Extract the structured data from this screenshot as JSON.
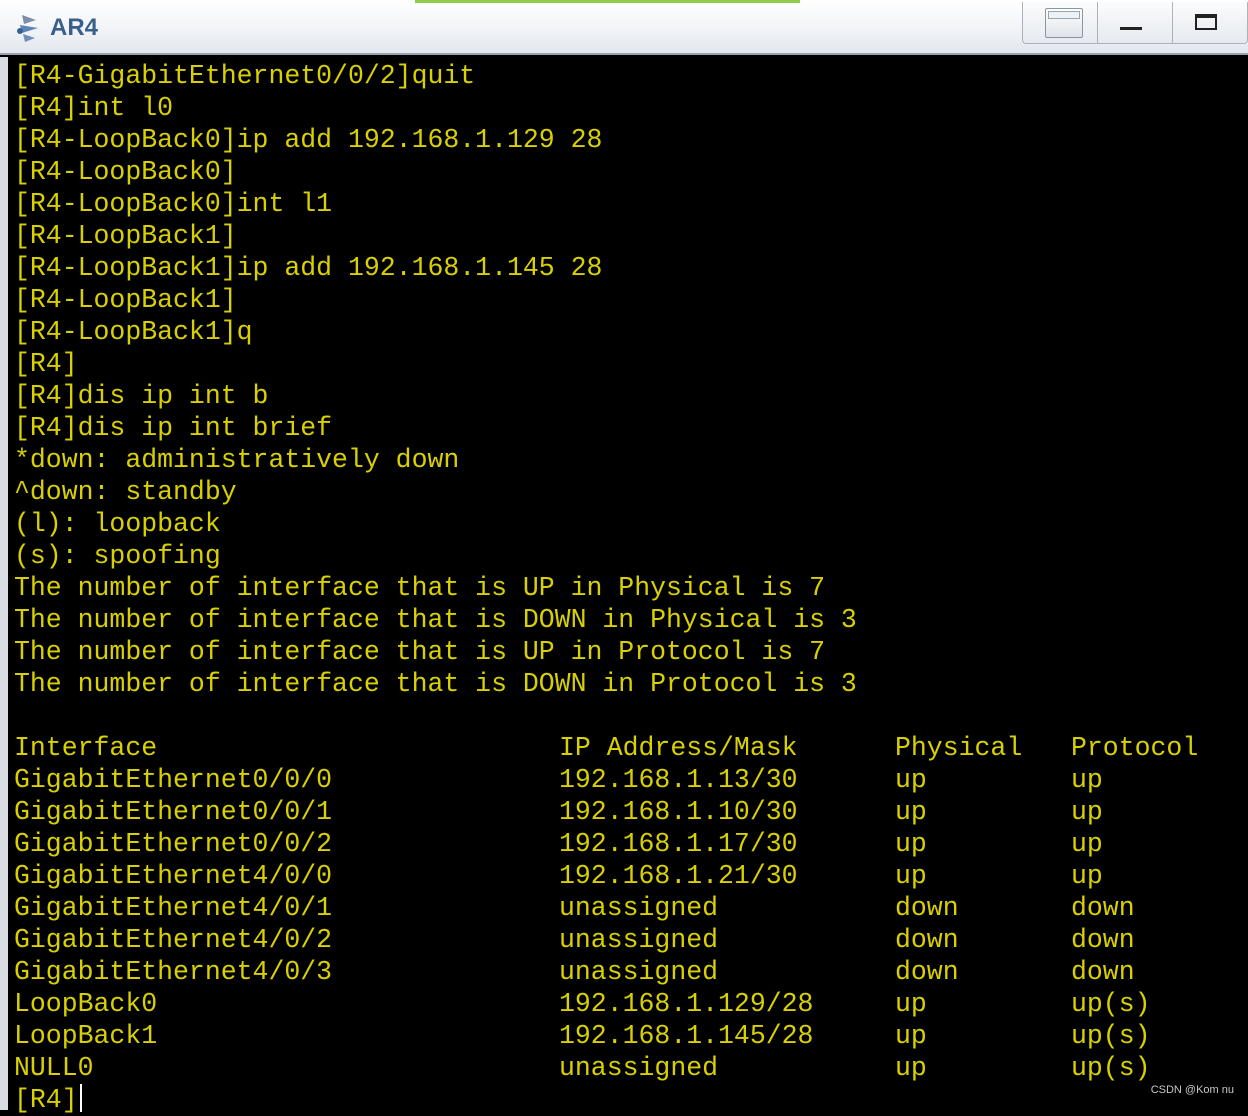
{
  "window": {
    "title": "AR4"
  },
  "console_lines": [
    "[R4-GigabitEthernet0/0/2]quit",
    "[R4]int l0",
    "[R4-LoopBack0]ip add 192.168.1.129 28",
    "[R4-LoopBack0]",
    "[R4-LoopBack0]int l1",
    "[R4-LoopBack1]",
    "[R4-LoopBack1]ip add 192.168.1.145 28",
    "[R4-LoopBack1]",
    "[R4-LoopBack1]q",
    "[R4]",
    "[R4]dis ip int b",
    "[R4]dis ip int brief",
    "*down: administratively down",
    "^down: standby",
    "(l): loopback",
    "(s): spoofing",
    "The number of interface that is UP in Physical is 7",
    "The number of interface that is DOWN in Physical is 3",
    "The number of interface that is UP in Protocol is 7",
    "The number of interface that is DOWN in Protocol is 3"
  ],
  "interface_table": {
    "headers": [
      "Interface",
      "IP Address/Mask",
      "Physical",
      "Protocol"
    ],
    "rows": [
      [
        "GigabitEthernet0/0/0",
        "192.168.1.13/30",
        "up",
        "up"
      ],
      [
        "GigabitEthernet0/0/1",
        "192.168.1.10/30",
        "up",
        "up"
      ],
      [
        "GigabitEthernet0/0/2",
        "192.168.1.17/30",
        "up",
        "up"
      ],
      [
        "GigabitEthernet4/0/0",
        "192.168.1.21/30",
        "up",
        "up"
      ],
      [
        "GigabitEthernet4/0/1",
        "unassigned",
        "down",
        "down"
      ],
      [
        "GigabitEthernet4/0/2",
        "unassigned",
        "down",
        "down"
      ],
      [
        "GigabitEthernet4/0/3",
        "unassigned",
        "down",
        "down"
      ],
      [
        "LoopBack0",
        "192.168.1.129/28",
        "up",
        "up(s)"
      ],
      [
        "LoopBack1",
        "192.168.1.145/28",
        "up",
        "up(s)"
      ],
      [
        "NULL0",
        "unassigned",
        "up",
        "up(s)"
      ]
    ]
  },
  "prompt": "[R4]",
  "watermark": "CSDN @Kom nu",
  "colors": {
    "terminal_text": "#d8d000",
    "terminal_bg": "#000000",
    "title_text": "#3a5f8c"
  },
  "icons": {
    "app": "router-app-icon",
    "restore": "restore-window-icon",
    "minimize": "minimize-icon",
    "maximize": "maximize-icon"
  }
}
